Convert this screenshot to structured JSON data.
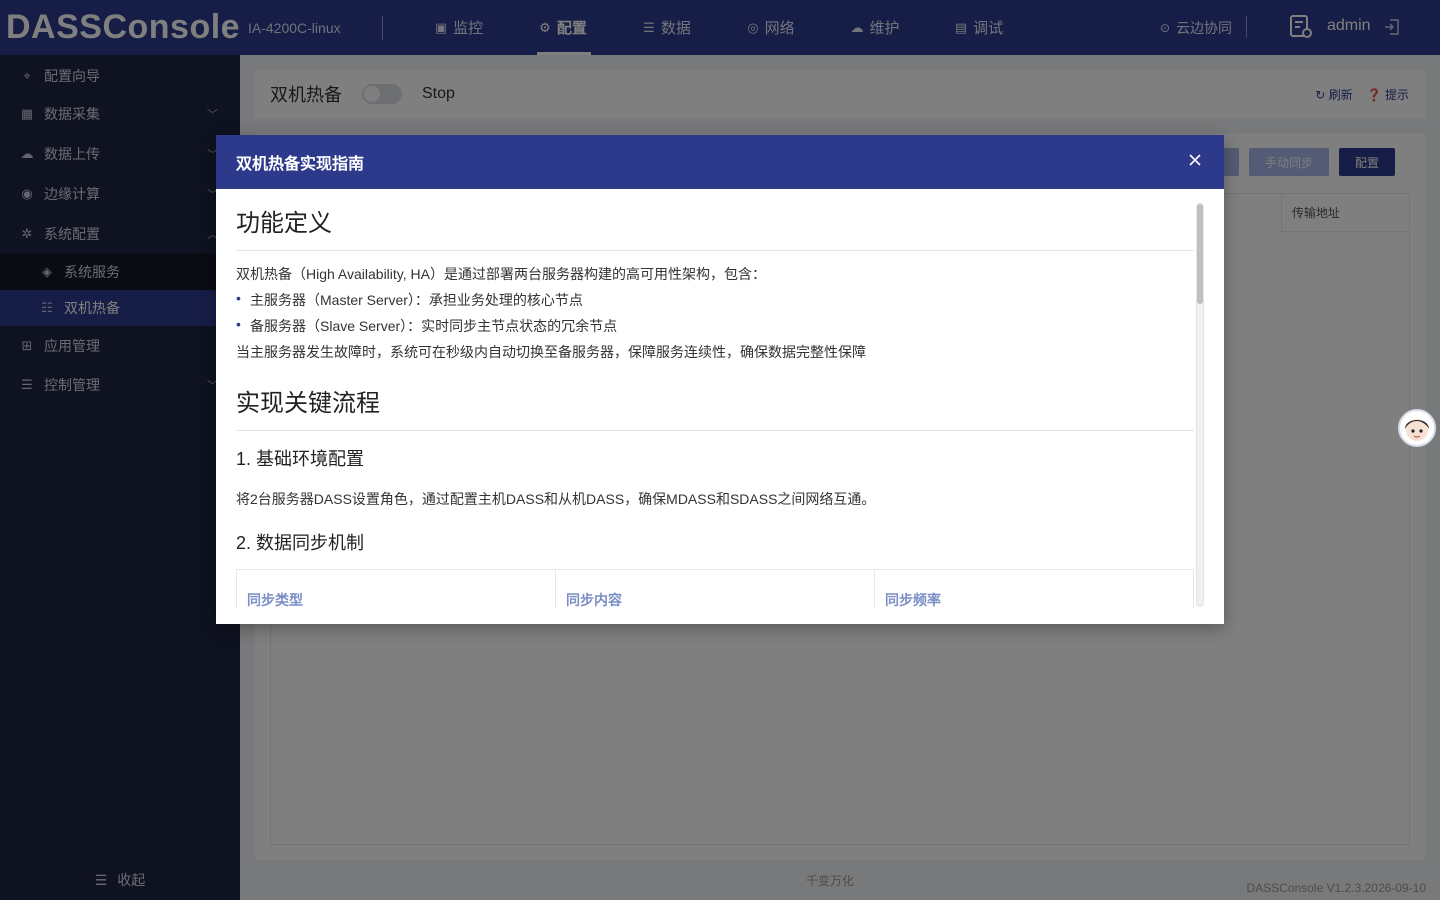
{
  "topbar": {
    "brand": "DASSConsole",
    "device": "IA-4200C-linux",
    "nav": [
      {
        "label": "监控",
        "icon": "monitor-icon"
      },
      {
        "label": "配置",
        "icon": "config-icon",
        "active": true
      },
      {
        "label": "数据",
        "icon": "database-icon"
      },
      {
        "label": "网络",
        "icon": "network-icon"
      },
      {
        "label": "维护",
        "icon": "maintenance-icon"
      },
      {
        "label": "调试",
        "icon": "debug-icon"
      }
    ],
    "cloud": "云边协同",
    "user": "admin"
  },
  "sidebar": {
    "items": [
      {
        "label": "配置向导",
        "icon": "wizard-icon"
      },
      {
        "label": "数据采集",
        "icon": "collect-icon"
      },
      {
        "label": "数据上传",
        "icon": "upload-icon"
      },
      {
        "label": "边缘计算",
        "icon": "edge-icon"
      },
      {
        "label": "系统配置",
        "icon": "settings-icon"
      },
      {
        "label": "应用管理",
        "icon": "apps-icon"
      },
      {
        "label": "控制管理",
        "icon": "control-icon"
      }
    ],
    "sub_items": [
      {
        "label": "系统服务",
        "icon": "service-icon"
      },
      {
        "label": "双机热备",
        "icon": "hotstandby-icon",
        "active": true
      }
    ],
    "collapse": "收起"
  },
  "page": {
    "title": "双机热备",
    "toggle_state": "Stop",
    "refresh": "刷新",
    "hint": "提示",
    "btn_manual_sync": "手动同步",
    "btn_config": "配置",
    "col_transfer_addr": "传输地址",
    "footer": "千变万化",
    "version": "DASSConsole V1.2.3.2026-09-10"
  },
  "modal": {
    "title": "双机热备实现指南",
    "h1_def": "功能定义",
    "p_intro": "双机热备（High Availability, HA）是通过部署两台服务器构建的高可用性架构，包含：",
    "li_master": "主服务器（Master Server）：承担业务处理的核心节点",
    "li_slave": "备服务器（Slave Server）：实时同步主节点状态的冗余节点",
    "p_failover": "当主服务器发生故障时，系统可在秒级内自动切换至备服务器，保障服务连续性，确保数据完整性保障",
    "h1_flow": "实现关键流程",
    "h2_env": "1. 基础环境配置",
    "p_env": "将2台服务器DASS设置角色，通过配置主机DASS和从机DASS，确保MDASS和SDASS之间网络互通。",
    "h2_sync": "2. 数据同步机制",
    "table_headers": [
      "同步类型",
      "同步内容",
      "同步频率"
    ]
  }
}
